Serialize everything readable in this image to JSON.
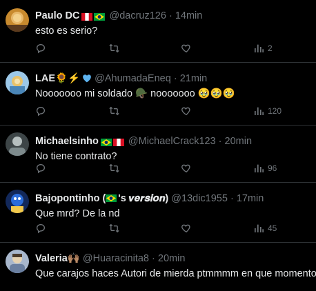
{
  "tweets": [
    {
      "name": "Paulo DC",
      "badges": [
        "peru-flag",
        "brazil-flag"
      ],
      "handle": "@dacruz126",
      "separator": "·",
      "time": "14min",
      "text": "esto es serio?",
      "views": "2",
      "avatar_colors": [
        "#e2a542",
        "#5b3a1e"
      ]
    },
    {
      "name": "LAE",
      "name_suffix": "🌻⚡️",
      "badges": [
        "blue-heart"
      ],
      "handle": "@AhumadaEneq",
      "separator": "·",
      "time": "21min",
      "text": "Nooooooo mi soldado 🪖 nooooooo 🥹🥹🥹",
      "views": "120",
      "avatar_colors": [
        "#9cc8e8",
        "#e8c26a"
      ]
    },
    {
      "name": "Michaelsinho",
      "badges": [
        "brazil-flag",
        "peru-flag"
      ],
      "handle": "@MichaelCrack123",
      "separator": "·",
      "time": "20min",
      "text": "No tiene contrato?",
      "views": "96",
      "avatar_colors": [
        "#7d8a8c",
        "#2d3436"
      ]
    },
    {
      "name": "Bajopontinho (",
      "name_flag": "brazil-flag",
      "name_tail": "'s 𝒗𝒆𝒓𝒔𝒊𝒐𝒏)",
      "handle": "@13dic1955",
      "separator": "·",
      "time": "17min",
      "text": "Que mrd? De la nd",
      "views": "45",
      "avatar_colors": [
        "#2b6cd9",
        "#12285a"
      ]
    },
    {
      "name": "Valeria",
      "name_suffix": "🙌🏽",
      "handle": "@Huaracinita8",
      "separator": "·",
      "time": "20min",
      "text": "Que carajos haces Autori de mierda ptmmmm en que momento",
      "avatar_colors": [
        "#d9c7a8",
        "#6a7fa0"
      ]
    }
  ],
  "colors": {
    "background": "#000000",
    "text": "#e7e9ea",
    "secondary": "#71767b",
    "divider": "#2f3336"
  },
  "icons": {
    "reply": "reply-icon",
    "retweet": "retweet-icon",
    "like": "heart-icon",
    "views": "views-chart-icon"
  }
}
